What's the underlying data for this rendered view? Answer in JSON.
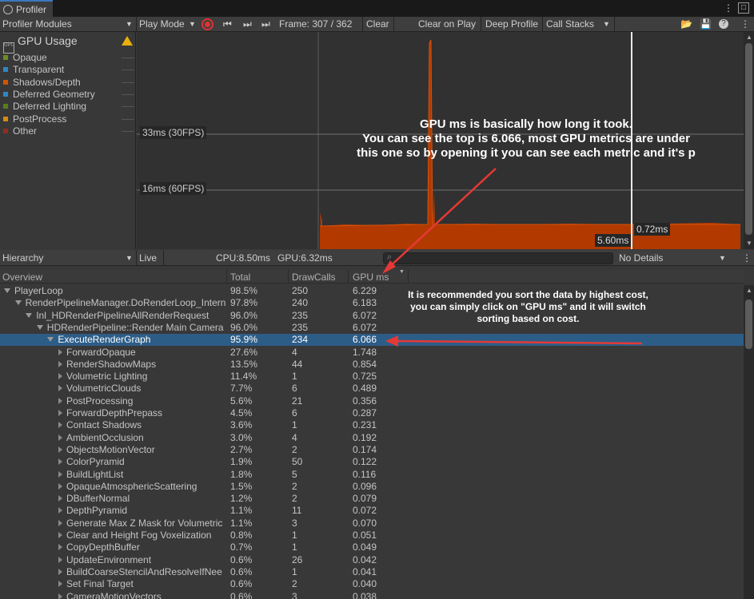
{
  "window": {
    "tab_title": "Profiler",
    "tab_menu": "⋮",
    "close": "□"
  },
  "toolbar": {
    "modules": "Profiler Modules",
    "play_mode": "Play Mode",
    "frame": "Frame: 307 / 362",
    "clear": "Clear",
    "clear_on_play": "Clear on Play",
    "deep_profile": "Deep Profile",
    "call_stacks": "Call Stacks"
  },
  "module": {
    "title": "GPU Usage",
    "legend": [
      {
        "label": "Opaque",
        "color": "#6b8e23"
      },
      {
        "label": "Transparent",
        "color": "#2e86c1"
      },
      {
        "label": "Shadows/Depth",
        "color": "#d35400"
      },
      {
        "label": "Deferred Geometry",
        "color": "#2e86c1"
      },
      {
        "label": "Deferred Lighting",
        "color": "#5a7d1a"
      },
      {
        "label": "PostProcess",
        "color": "#d68910"
      },
      {
        "label": "Other",
        "color": "#922b21"
      }
    ]
  },
  "chart": {
    "line_33": "33ms (30FPS)",
    "line_16": "16ms (60FPS)",
    "marker_a": "0.72ms",
    "marker_b": "5.60ms",
    "fill_color": "#b23a00"
  },
  "annotation1": {
    "lines": [
      "GPU ms is basically how long it took.",
      "You can see the top is 6.066, most GPU metrics are under",
      "this one so by opening it you can see each metric and it's p"
    ]
  },
  "annotation2": {
    "lines": [
      "It is recommended you sort the data by highest cost,",
      "you can simply click on \"GPU ms\" and it will switch",
      "sorting based on cost."
    ]
  },
  "details": {
    "view": "Hierarchy",
    "live": "Live",
    "cpu": "CPU:8.50ms",
    "gpu": "GPU:6.32ms",
    "no_details": "No Details"
  },
  "columns": {
    "overview": "Overview",
    "total": "Total",
    "drawcalls": "DrawCalls",
    "gpums": "GPU ms"
  },
  "rows": [
    {
      "name": "PlayerLoop",
      "total": "98.5%",
      "dc": "250",
      "ms": "6.229"
    },
    {
      "name": "RenderPipelineManager.DoRenderLoop_Intern",
      "total": "97.8%",
      "dc": "240",
      "ms": "6.183"
    },
    {
      "name": "Inl_HDRenderPipelineAllRenderRequest",
      "total": "96.0%",
      "dc": "235",
      "ms": "6.072"
    },
    {
      "name": "HDRenderPipeline::Render Main Camera",
      "total": "96.0%",
      "dc": "235",
      "ms": "6.072"
    },
    {
      "name": "ExecuteRenderGraph",
      "total": "95.9%",
      "dc": "234",
      "ms": "6.066"
    },
    {
      "name": "ForwardOpaque",
      "total": "27.6%",
      "dc": "4",
      "ms": "1.748"
    },
    {
      "name": "RenderShadowMaps",
      "total": "13.5%",
      "dc": "44",
      "ms": "0.854"
    },
    {
      "name": "Volumetric Lighting",
      "total": "11.4%",
      "dc": "1",
      "ms": "0.725"
    },
    {
      "name": "VolumetricClouds",
      "total": "7.7%",
      "dc": "6",
      "ms": "0.489"
    },
    {
      "name": "PostProcessing",
      "total": "5.6%",
      "dc": "21",
      "ms": "0.356"
    },
    {
      "name": "ForwardDepthPrepass",
      "total": "4.5%",
      "dc": "6",
      "ms": "0.287"
    },
    {
      "name": "Contact Shadows",
      "total": "3.6%",
      "dc": "1",
      "ms": "0.231"
    },
    {
      "name": "AmbientOcclusion",
      "total": "3.0%",
      "dc": "4",
      "ms": "0.192"
    },
    {
      "name": "ObjectsMotionVector",
      "total": "2.7%",
      "dc": "2",
      "ms": "0.174"
    },
    {
      "name": "ColorPyramid",
      "total": "1.9%",
      "dc": "50",
      "ms": "0.122"
    },
    {
      "name": "BuildLightList",
      "total": "1.8%",
      "dc": "5",
      "ms": "0.116"
    },
    {
      "name": "OpaqueAtmosphericScattering",
      "total": "1.5%",
      "dc": "2",
      "ms": "0.096"
    },
    {
      "name": "DBufferNormal",
      "total": "1.2%",
      "dc": "2",
      "ms": "0.079"
    },
    {
      "name": "DepthPyramid",
      "total": "1.1%",
      "dc": "11",
      "ms": "0.072"
    },
    {
      "name": "Generate Max Z Mask for Volumetric",
      "total": "1.1%",
      "dc": "3",
      "ms": "0.070"
    },
    {
      "name": "Clear and Height Fog Voxelization",
      "total": "0.8%",
      "dc": "1",
      "ms": "0.051"
    },
    {
      "name": "CopyDepthBuffer",
      "total": "0.7%",
      "dc": "1",
      "ms": "0.049"
    },
    {
      "name": "UpdateEnvironment",
      "total": "0.6%",
      "dc": "26",
      "ms": "0.042"
    },
    {
      "name": "BuildCoarseStencilAndResolveIfNee",
      "total": "0.6%",
      "dc": "1",
      "ms": "0.041"
    },
    {
      "name": "Set Final Target",
      "total": "0.6%",
      "dc": "2",
      "ms": "0.040"
    },
    {
      "name": "CameraMotionVectors",
      "total": "0.6%",
      "dc": "3",
      "ms": "0.038"
    }
  ]
}
